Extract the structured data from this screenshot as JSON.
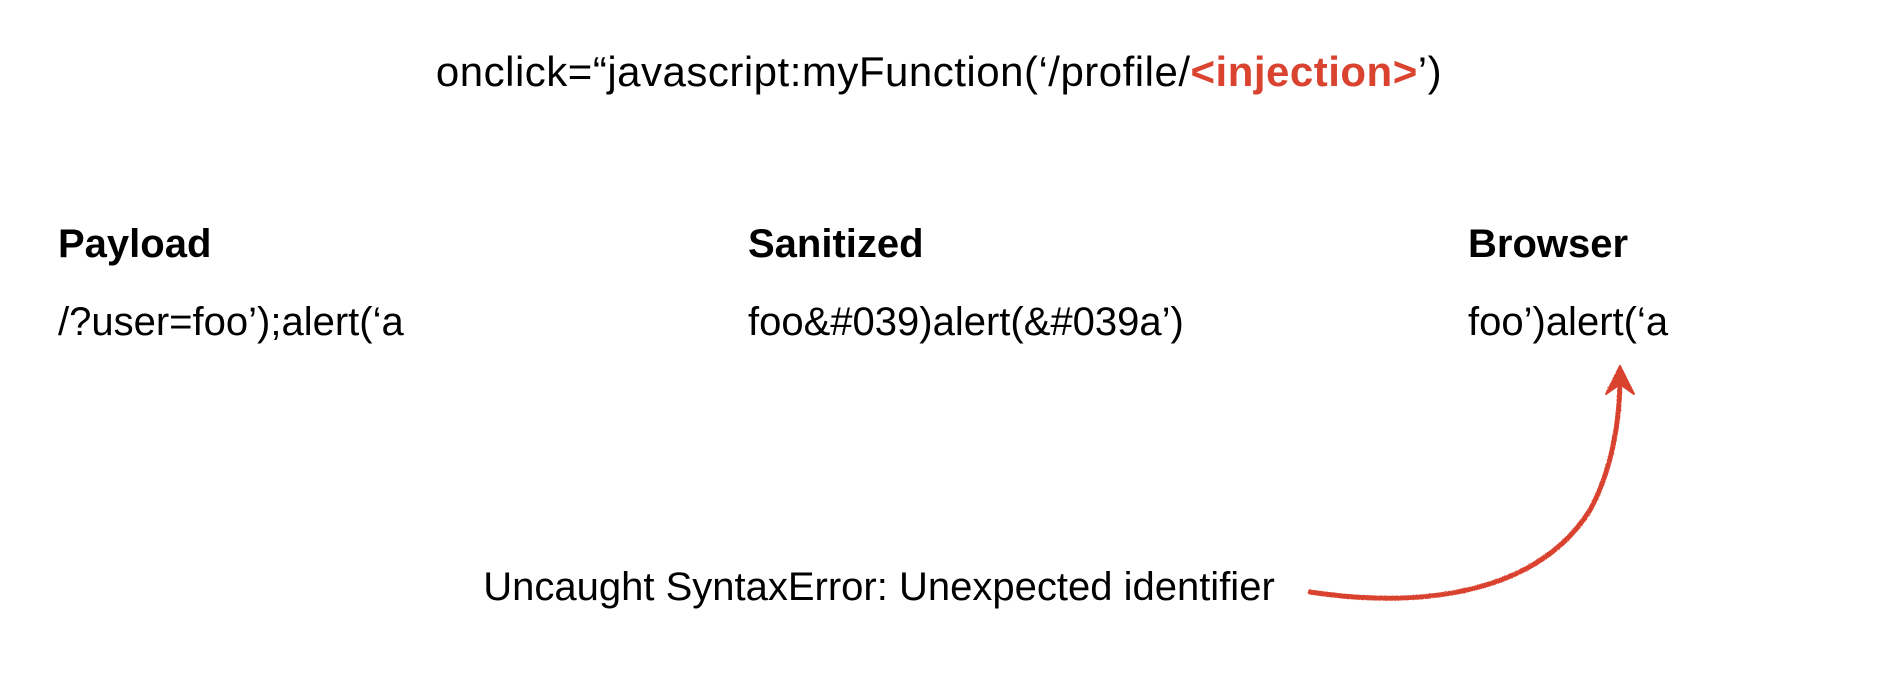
{
  "top": {
    "prefix": "onclick=“javascript:myFunction(‘/profile/",
    "injection": "<injection>",
    "suffix": "’)"
  },
  "columns": {
    "payload": {
      "header": "Payload",
      "value": "/?user=foo’);alert(‘a"
    },
    "sanitized": {
      "header": "Sanitized",
      "value": "foo&#039)alert(&#039a’)"
    },
    "browser": {
      "header": "Browser",
      "value": "foo’)alert(‘a"
    }
  },
  "error": "Uncaught SyntaxError: Unexpected identifier",
  "colors": {
    "accent": "#d9432f"
  }
}
